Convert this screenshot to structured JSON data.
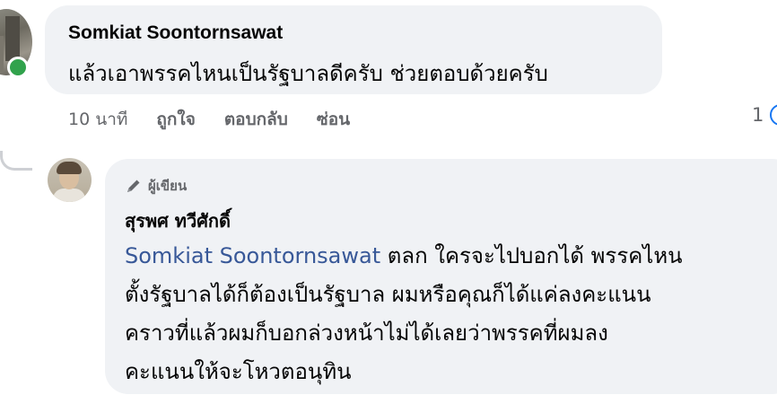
{
  "comment": {
    "author": "Somkiat Soontornsawat",
    "text": "แล้วเอาพรรคไหนเป็นรัฐบาลดีครับ ช่วยตอบด้วยครับ",
    "online": true,
    "actions": {
      "time": "10 นาที",
      "like": "ถูกใจ",
      "reply": "ตอบกลับ",
      "hide": "ซ่อน"
    },
    "reaction_count": "1"
  },
  "reply": {
    "badge": "ผู้เขียน",
    "badge_icon": "pencil-icon",
    "author": "สุรพศ ทวีศักดิ์",
    "mention": "Somkiat Soontornsawat",
    "lines": [
      " ตลก ใครจะไปบอกได้ พรรคไหน",
      "ตั้งรัฐบาลได้ก็ต้องเป็นรัฐบาล ผมหรือคุณก็ได้แค่ลงคะแนน",
      "คราวที่แล้วผมก็บอกล่วงหน้าไม่ได้เลยว่าพรรคที่ผมลง",
      "คะแนนให้จะโหวตอนุทิน"
    ]
  },
  "colors": {
    "bubble": "#f0f2f5",
    "online": "#31a24c",
    "mention": "#385898",
    "secondary_text": "#65676b"
  }
}
